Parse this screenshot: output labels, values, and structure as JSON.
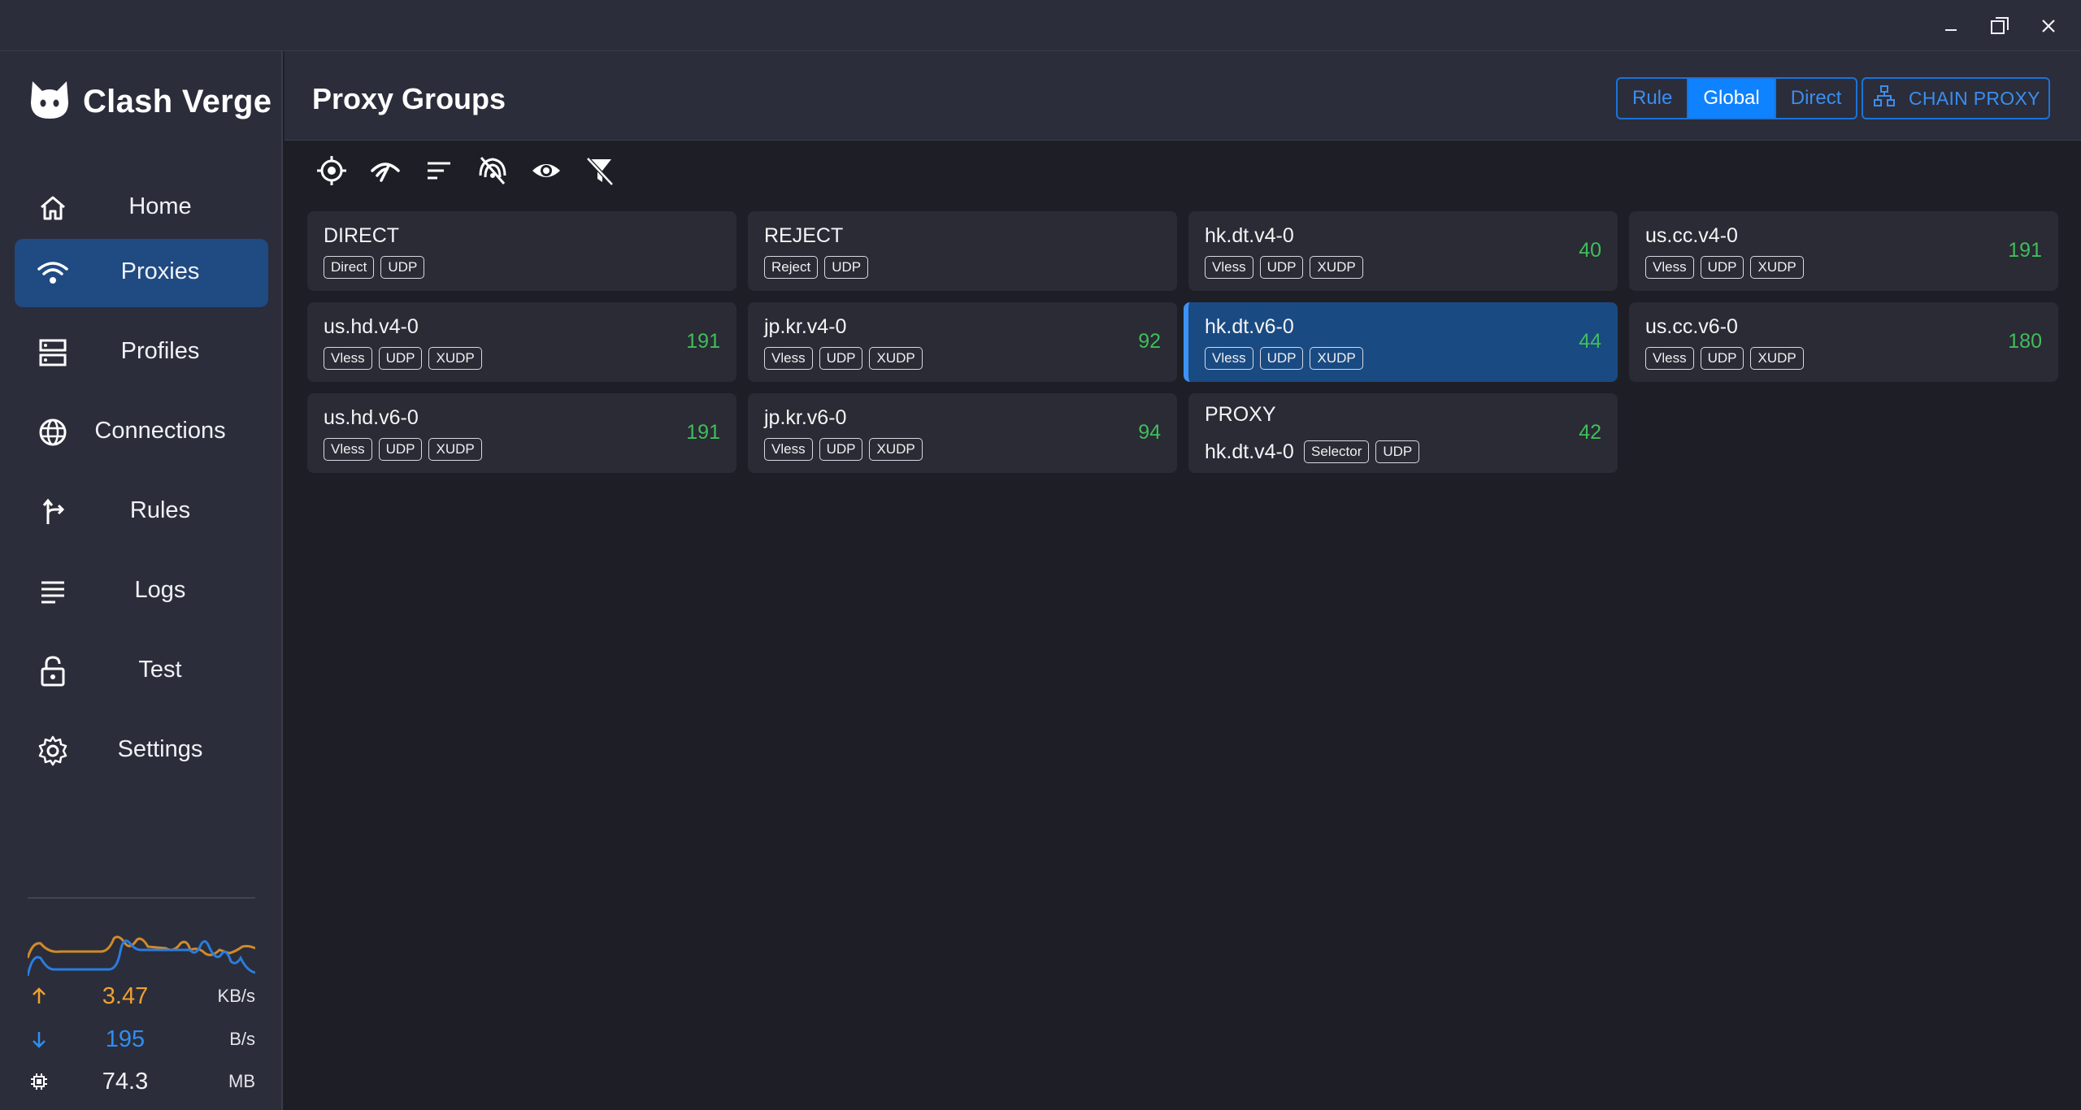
{
  "app": {
    "name": "Clash Verge"
  },
  "window_controls": {
    "minimize": "minimize-icon",
    "maximize": "maximize-icon",
    "close": "close-icon"
  },
  "sidebar": {
    "items": [
      {
        "label": "Home",
        "icon": "home-icon",
        "active": false
      },
      {
        "label": "Proxies",
        "icon": "wifi-icon",
        "active": true
      },
      {
        "label": "Profiles",
        "icon": "server-icon",
        "active": false
      },
      {
        "label": "Connections",
        "icon": "globe-icon",
        "active": false
      },
      {
        "label": "Rules",
        "icon": "fork-arrow-icon",
        "active": false
      },
      {
        "label": "Logs",
        "icon": "lines-icon",
        "active": false
      },
      {
        "label": "Test",
        "icon": "lock-icon",
        "active": false
      },
      {
        "label": "Settings",
        "icon": "gear-icon",
        "active": false
      }
    ],
    "traffic": {
      "upload": {
        "value": "3.47",
        "unit": "KB/s",
        "color": "#f0a030"
      },
      "download": {
        "value": "195",
        "unit": "B/s",
        "color": "#2f8ef2"
      },
      "memory": {
        "value": "74.3",
        "unit": "MB"
      }
    }
  },
  "header": {
    "title": "Proxy Groups",
    "modes": [
      {
        "label": "Rule",
        "active": false
      },
      {
        "label": "Global",
        "active": true
      },
      {
        "label": "Direct",
        "active": false
      }
    ],
    "chain_label": "CHAIN PROXY"
  },
  "toolbar": [
    "locate-icon",
    "speed-test-icon",
    "sort-icon",
    "signal-off-icon",
    "eye-icon",
    "filter-off-icon"
  ],
  "colors": {
    "accent": "#0f82ff",
    "latency": "#3fbe5c",
    "selected_card": "#1a4a82"
  },
  "proxies": [
    {
      "name": "DIRECT",
      "tags": [
        "Direct",
        "UDP"
      ],
      "latency": ""
    },
    {
      "name": "REJECT",
      "tags": [
        "Reject",
        "UDP"
      ],
      "latency": ""
    },
    {
      "name": "hk.dt.v4-0",
      "tags": [
        "Vless",
        "UDP",
        "XUDP"
      ],
      "latency": "40"
    },
    {
      "name": "us.cc.v4-0",
      "tags": [
        "Vless",
        "UDP",
        "XUDP"
      ],
      "latency": "191"
    },
    {
      "name": "us.hd.v4-0",
      "tags": [
        "Vless",
        "UDP",
        "XUDP"
      ],
      "latency": "191"
    },
    {
      "name": "jp.kr.v4-0",
      "tags": [
        "Vless",
        "UDP",
        "XUDP"
      ],
      "latency": "92"
    },
    {
      "name": "hk.dt.v6-0",
      "tags": [
        "Vless",
        "UDP",
        "XUDP"
      ],
      "latency": "44",
      "selected": true
    },
    {
      "name": "us.cc.v6-0",
      "tags": [
        "Vless",
        "UDP",
        "XUDP"
      ],
      "latency": "180"
    },
    {
      "name": "us.hd.v6-0",
      "tags": [
        "Vless",
        "UDP",
        "XUDP"
      ],
      "latency": "191"
    },
    {
      "name": "jp.kr.v6-0",
      "tags": [
        "Vless",
        "UDP",
        "XUDP"
      ],
      "latency": "94"
    },
    {
      "name": "PROXY",
      "now": "hk.dt.v4-0",
      "tags": [
        "Selector",
        "UDP"
      ],
      "latency": "42"
    }
  ]
}
